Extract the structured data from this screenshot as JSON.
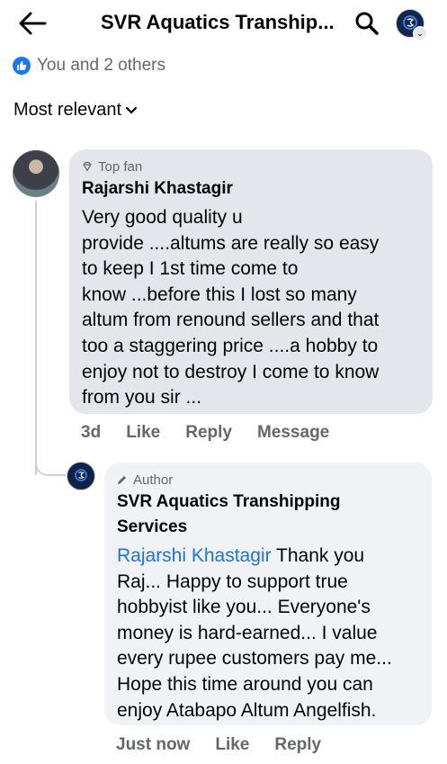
{
  "header": {
    "title": "SVR Aquatics Tranship..."
  },
  "reactions": {
    "summary": "You and 2 others"
  },
  "sort": {
    "label": "Most relevant"
  },
  "comment": {
    "badge": "Top fan",
    "author": "Rajarshi Khastagir",
    "text_lines": [
      "Very good quality u",
      "provide ....altums are really so easy",
      "to keep I 1st time come to",
      "know ...before this I lost so many",
      "altum from renound sellers and that",
      "too a staggering price ....a hobby to",
      "enjoy not to destroy I come to know",
      "from you sir ..."
    ],
    "time": "3d",
    "actions": [
      "Like",
      "Reply",
      "Message"
    ]
  },
  "reply": {
    "badge": "Author",
    "author_line1": "SVR Aquatics Transhipping",
    "author_line2": "Services",
    "mention": "Rajarshi Khastagir",
    "text_first_line_rest": " Thank you",
    "text_lines": [
      "Raj... Happy to support true",
      "hobbyist like you... Everyone's",
      "money is hard-earned... I value",
      "every rupee customers pay me...",
      "Hope this time around you can",
      "enjoy Atabapo Altum Angelfish."
    ],
    "time": "Just now",
    "actions": [
      "Like",
      "Reply"
    ]
  },
  "colors": {
    "link": "#1a73e8",
    "like_badge": "#1877f2",
    "secondary_text": "#65676b"
  }
}
